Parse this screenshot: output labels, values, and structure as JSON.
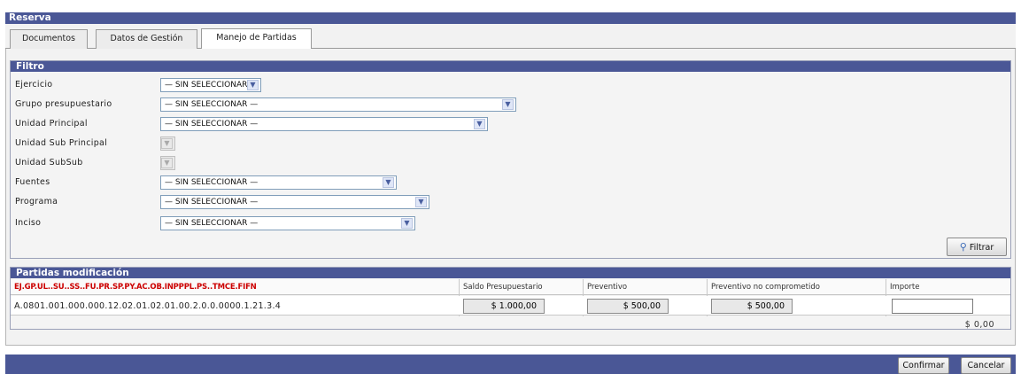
{
  "window": {
    "title": "Reserva"
  },
  "tabs": [
    {
      "label": "Documentos"
    },
    {
      "label": "Datos de Gestión"
    },
    {
      "label": "Manejo de Partidas"
    }
  ],
  "filtro": {
    "title": "Filtro",
    "fields": [
      {
        "label": "Ejercicio",
        "value": "— SIN SELECCIONAR —",
        "enabled": true
      },
      {
        "label": "Grupo presupuestario",
        "value": "— SIN SELECCIONAR —",
        "enabled": true
      },
      {
        "label": "Unidad Principal",
        "value": "— SIN SELECCIONAR —",
        "enabled": true
      },
      {
        "label": "Unidad Sub Principal",
        "value": "",
        "enabled": false
      },
      {
        "label": "Unidad SubSub",
        "value": "",
        "enabled": false
      },
      {
        "label": "Fuentes",
        "value": "— SIN SELECCIONAR —",
        "enabled": true
      },
      {
        "label": "Programa",
        "value": "— SIN SELECCIONAR —",
        "enabled": true
      },
      {
        "label": "Inciso",
        "value": "— SIN SELECCIONAR —",
        "enabled": true
      }
    ],
    "filter_button": "Filtrar"
  },
  "partidas": {
    "title": "Partidas modificación",
    "columns": {
      "code": "EJ.GP.UL..SU..SS..FU.PR.SP.PY.AC.OB.INPPPL.PS..TMCE.FIFN",
      "saldo": "Saldo Presupuestario",
      "preventivo": "Preventivo",
      "no_comprometido": "Preventivo no comprometido",
      "importe": "Importe"
    },
    "rows": [
      {
        "code": "A.0801.001.000.000.12.02.01.02.01.00.2.0.0.0000.1.21.3.4",
        "saldo": "$ 1.000,00",
        "preventivo": "$ 500,00",
        "no_comprometido": "$ 500,00",
        "importe": ""
      }
    ],
    "total": "$ 0,00"
  },
  "footer": {
    "confirm": "Confirmar",
    "cancel": "Cancelar"
  },
  "icons": {
    "filter": "funnel-icon",
    "dropdown": "chevron-down-icon"
  },
  "colors": {
    "header_bar": "#4a5796",
    "code_header": "#cc0000"
  }
}
